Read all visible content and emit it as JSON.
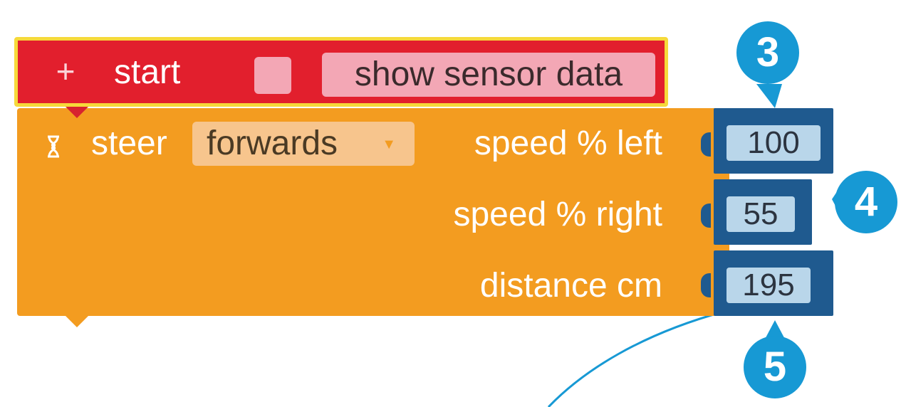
{
  "start_block": {
    "plus_icon": "+",
    "label": "start",
    "option_label": "show sensor data"
  },
  "steer_block": {
    "label": "steer",
    "direction_selected": "forwards",
    "params": [
      {
        "label": "speed %  left",
        "value": "100"
      },
      {
        "label": "speed %  right",
        "value": "55"
      },
      {
        "label": "distance cm",
        "value": "195"
      }
    ]
  },
  "callouts": [
    "3",
    "4",
    "5"
  ],
  "colors": {
    "start_block": "#e21f2d",
    "start_border": "#f6d93a",
    "steer_block": "#f39c20",
    "number_block": "#1f5a8f",
    "number_field": "#b9d6ea",
    "callout": "#1799d4"
  },
  "icons": {
    "plus": "plus-icon",
    "hourglass": "hourglass-icon",
    "dropdown": "chevron-down-icon"
  }
}
